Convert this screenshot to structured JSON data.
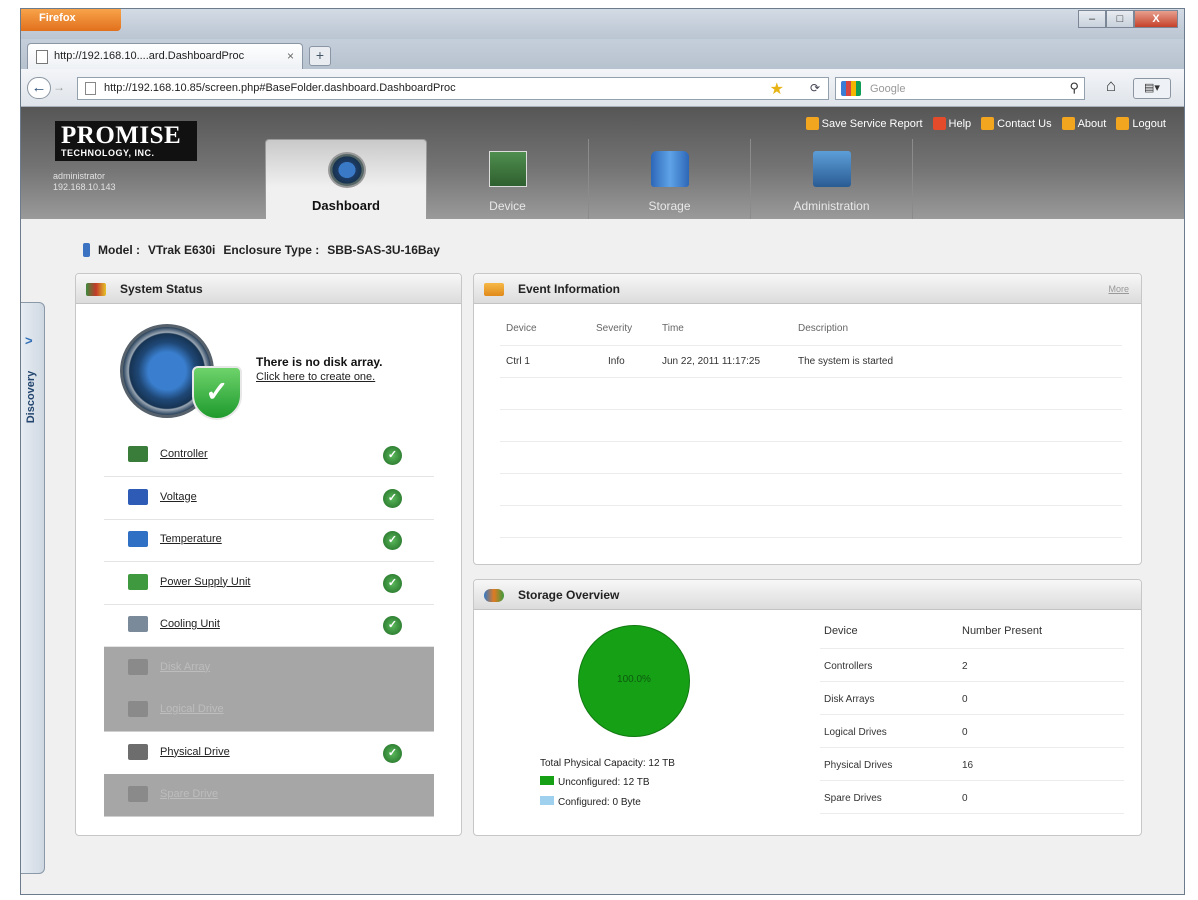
{
  "browser": {
    "app_button": "Firefox",
    "tab_title": "http://192.168.10....ard.DashboardProc",
    "tab_close": "×",
    "new_tab": "+",
    "url": "http://192.168.10.85/screen.php#BaseFolder.dashboard.DashboardProc",
    "search_placeholder": "Google",
    "window_controls": [
      "–",
      "□",
      "X"
    ]
  },
  "header": {
    "logo_main": "PROMISE",
    "logo_sub": "TECHNOLOGY, INC.",
    "user": "administrator",
    "ip": "192.168.10.143",
    "links": [
      "Save Service Report",
      "Help",
      "Contact Us",
      "About",
      "Logout"
    ],
    "tabs": [
      "Dashboard",
      "Device",
      "Storage",
      "Administration"
    ]
  },
  "sidebar": {
    "discovery_label": "Discovery",
    "chevron": ">"
  },
  "model": {
    "model_label": "Model :",
    "model_value": "VTrak E630i",
    "enclosure_label": "Enclosure Type :",
    "enclosure_value": "SBB-SAS-3U-16Bay"
  },
  "system_status": {
    "title": "System Status",
    "message": "There is no disk array.",
    "create_link": "Click here to create one.",
    "items": [
      {
        "label": "Controller",
        "enabled": true
      },
      {
        "label": "Voltage",
        "enabled": true
      },
      {
        "label": "Temperature",
        "enabled": true
      },
      {
        "label": "Power Supply Unit",
        "enabled": true
      },
      {
        "label": "Cooling Unit",
        "enabled": true
      },
      {
        "label": "Disk Array",
        "enabled": false
      },
      {
        "label": "Logical Drive",
        "enabled": false
      },
      {
        "label": "Physical Drive",
        "enabled": true
      },
      {
        "label": "Spare Drive",
        "enabled": false
      }
    ]
  },
  "event_info": {
    "title": "Event Information",
    "more": "More",
    "columns": [
      "Device",
      "Severity",
      "Time",
      "Description"
    ],
    "rows": [
      [
        "Ctrl 1",
        "Info",
        "Jun 22, 2011 11:17:25",
        "The system is started"
      ]
    ]
  },
  "storage_overview": {
    "title": "Storage Overview",
    "pie_label": "100.0%",
    "unconfigured_fraction": 1.0,
    "total_capacity": "Total Physical Capacity: 12 TB",
    "legend": [
      {
        "label": "Unconfigured: 12 TB",
        "color": "#15a016"
      },
      {
        "label": "Configured: 0 Byte",
        "color": "#9fd0ee"
      }
    ],
    "columns": [
      "Device",
      "Number Present"
    ],
    "rows": [
      [
        "Controllers",
        "2"
      ],
      [
        "Disk Arrays",
        "0"
      ],
      [
        "Logical Drives",
        "0"
      ],
      [
        "Physical Drives",
        "16"
      ],
      [
        "Spare Drives",
        "0"
      ]
    ]
  }
}
